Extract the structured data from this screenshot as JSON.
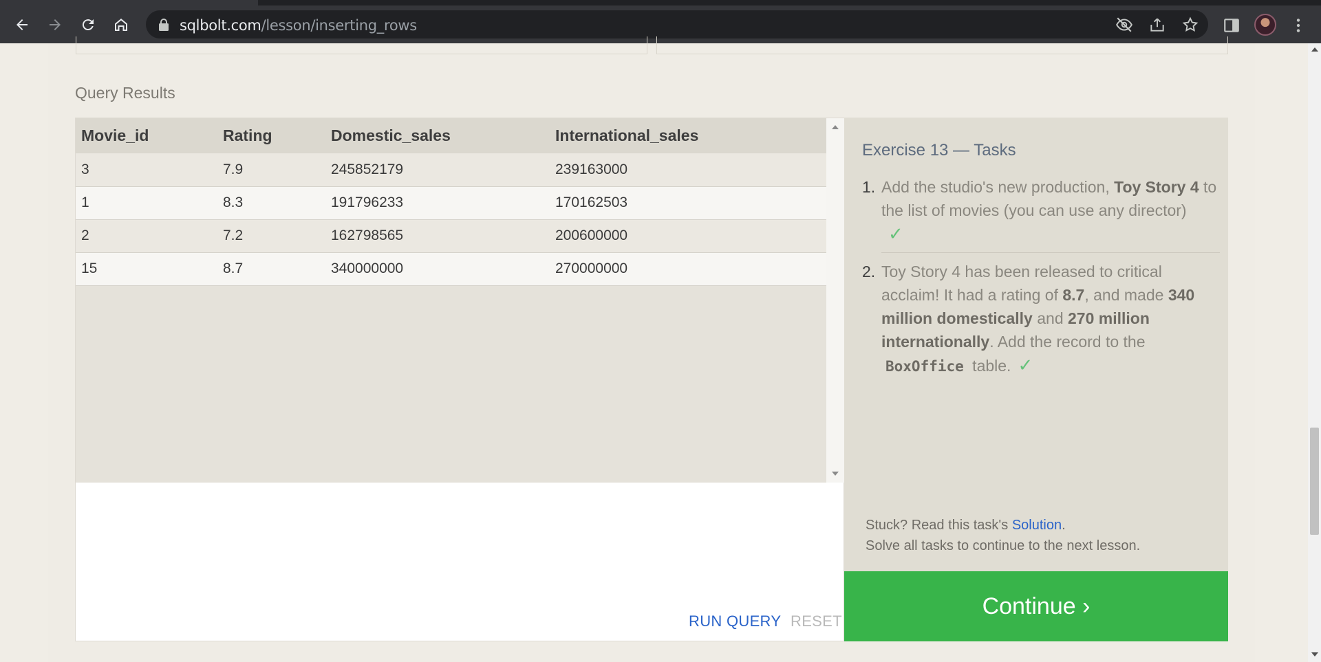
{
  "browser": {
    "url_host": "sqlbolt.com",
    "url_path": "/lesson/inserting_rows"
  },
  "results": {
    "label": "Query Results",
    "columns": [
      "Movie_id",
      "Rating",
      "Domestic_sales",
      "International_sales"
    ],
    "rows": [
      [
        "3",
        "7.9",
        "245852179",
        "239163000"
      ],
      [
        "1",
        "8.3",
        "191796233",
        "170162503"
      ],
      [
        "2",
        "7.2",
        "162798565",
        "200600000"
      ],
      [
        "15",
        "8.7",
        "340000000",
        "270000000"
      ]
    ],
    "run_query_label": "RUN QUERY",
    "reset_label": "RESET"
  },
  "tasks": {
    "title": "Exercise 13 — Tasks",
    "task1": {
      "num": "1.",
      "text_a": "Add the studio's new production, ",
      "bold_a": "Toy Story 4",
      "text_b": " to the list of movies (you can use any director)",
      "check": "✓"
    },
    "task2": {
      "num": "2.",
      "text_a": "Toy Story 4 has been released to critical acclaim! It had a rating of ",
      "bold_a": "8.7",
      "text_b": ", and made ",
      "bold_b": "340 million domestically",
      "text_c": " and ",
      "bold_c": "270 million internationally",
      "text_d": ". Add the record to the ",
      "code": "BoxOffice",
      "text_e": " table.",
      "check": "✓"
    },
    "stuck_prefix": "Stuck? Read this task's ",
    "solution_link": "Solution",
    "stuck_suffix": ".",
    "solve_all": "Solve all tasks to continue to the next lesson.",
    "continue_label": "Continue ›"
  }
}
